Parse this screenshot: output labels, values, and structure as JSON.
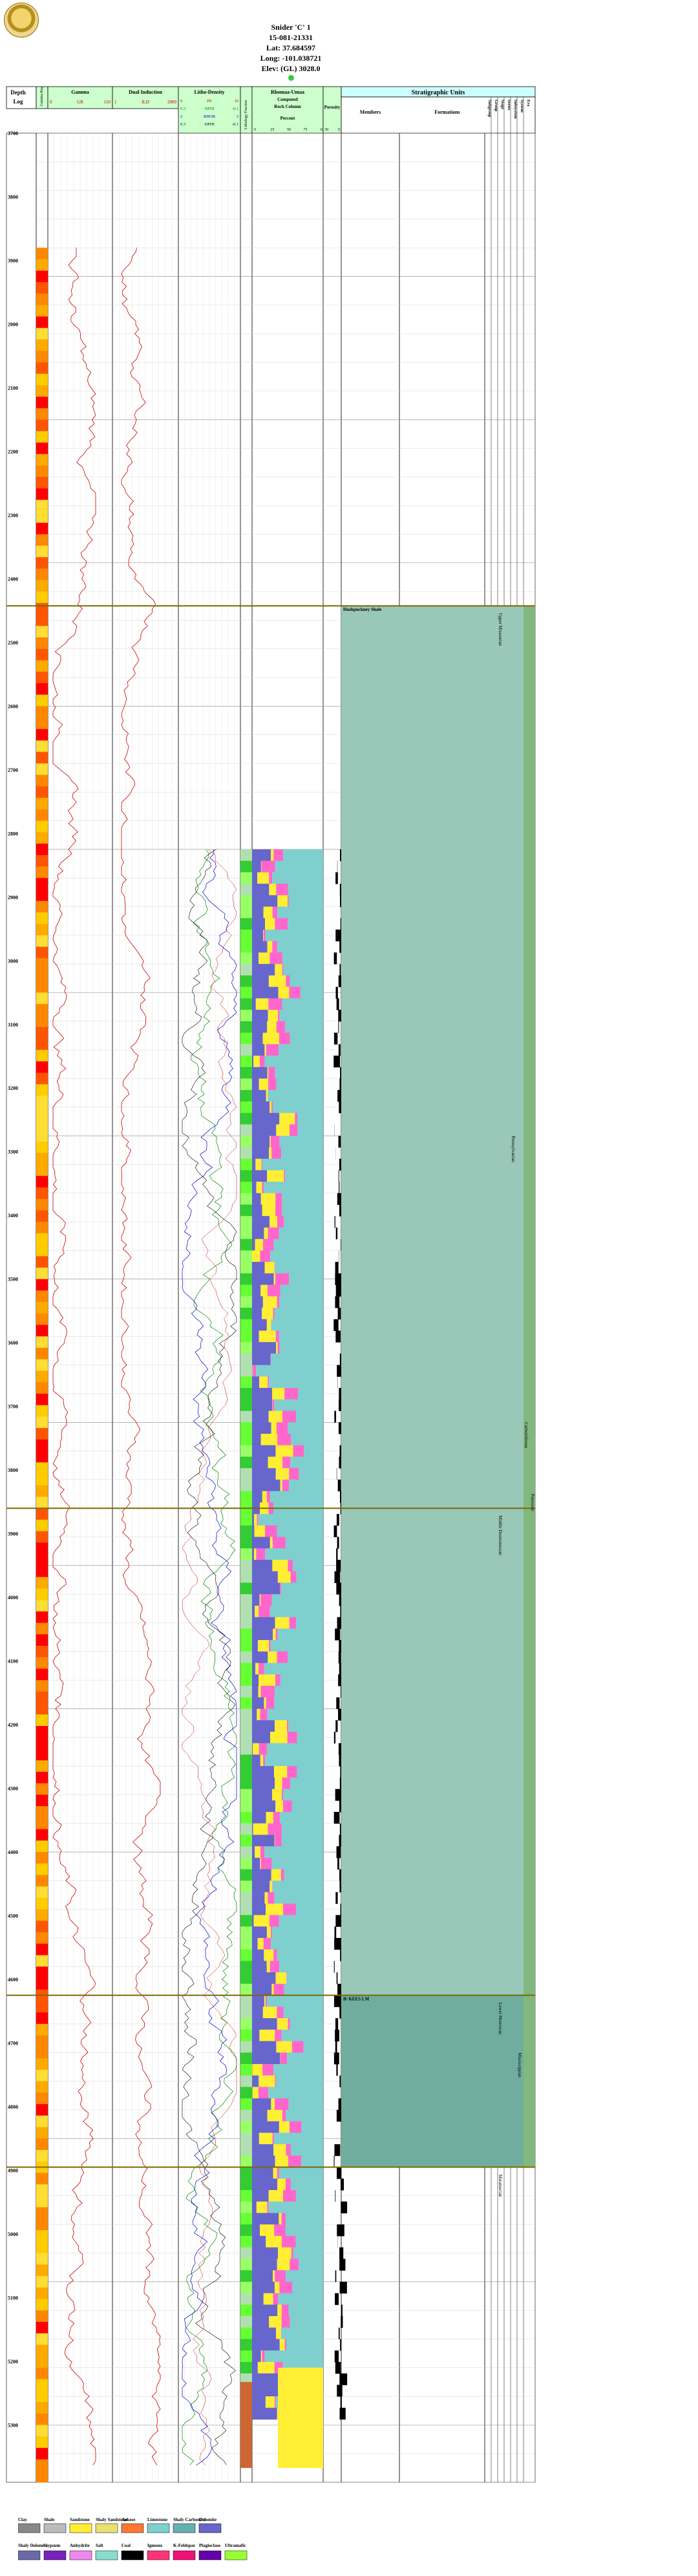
{
  "header": {
    "well_name": "Snider 'C' 1",
    "api": "15-081-21331",
    "lat": "Lat: 37.684597",
    "long": "Long: -101.038721",
    "elev": "Elev: (GL) 3028.0"
  },
  "columns": {
    "depth": [
      "Depth",
      "Log"
    ],
    "gamma_fr": "Gamma Ray",
    "gamma": {
      "title": "Gamma",
      "min": "0",
      "curve": "GR",
      "max": "150"
    },
    "induction": {
      "title": "Dual Induction",
      "min": "1",
      "curve": "ILD",
      "max": "2000"
    },
    "litho": {
      "title": "Litho-Density",
      "rows": [
        {
          "min": "0",
          "curve": "PE",
          "max": "10",
          "color": "#cc0000"
        },
        {
          "min": "0.3",
          "curve": "NPHI",
          "max": "-0.1",
          "color": "#008800"
        },
        {
          "min": "2",
          "curve": "RHOB",
          "max": "3",
          "color": "#0000cc"
        },
        {
          "min": "0.3",
          "curve": "DPHI",
          "max": "-0.1",
          "color": "#000000"
        }
      ]
    },
    "rhomaa_fr": "Lithology Fraction",
    "comp": {
      "title": "Rhomaa-Umaa",
      "sub1": "Computed",
      "sub2": "Rock Column",
      "sub3": "Percent",
      "ticks": [
        "0",
        "25",
        "50",
        "75",
        "100"
      ]
    },
    "porosity": {
      "title": "Porosity",
      "ticks": [
        "30",
        "0"
      ]
    },
    "strat": {
      "title": "Stratigraphic Units",
      "members": "Members",
      "formations": "Formations",
      "verticals": [
        "Subgroup",
        "Group",
        "Stage",
        "Series",
        "Subsystem",
        "System",
        "Era"
      ]
    }
  },
  "depth_ticks": [
    "3700",
    "3800",
    "3900",
    "2000",
    "2100",
    "2200",
    "2300",
    "2400",
    "2500",
    "2600",
    "2700",
    "2800",
    "2900",
    "3000",
    "3100",
    "3200",
    "3300",
    "3400",
    "3500",
    "3600",
    "3700",
    "3800",
    "3900",
    "4000",
    "4100",
    "4200",
    "4300",
    "4400",
    "4500",
    "4600",
    "4700",
    "4800",
    "4900",
    "5000",
    "5100",
    "5200",
    "5300"
  ],
  "tops": [
    {
      "label": "Hushpuckney Shale",
      "depth": 4030
    },
    {
      "label": "",
      "depth": 4660
    },
    {
      "label": "B/ KEES LM",
      "depth": 5000
    },
    {
      "label": "",
      "depth": 5120
    }
  ],
  "strat_labels": {
    "series_upper": "Upper Missourian",
    "series_middle": "Middle Desmoinesian",
    "series_lower": "Lower Morrowan",
    "system": "Pennsylvanian",
    "subsystem": "Mississippian",
    "era": "Paleozoic",
    "era2": "Carboniferous",
    "meramecian": "Meramecian"
  },
  "legend": {
    "row1": [
      "Clay",
      "Shale",
      "Sandstone",
      "Shaly Sandstone",
      "Arkose",
      "Limestone",
      "Shaly Carbonate",
      "Dolomite"
    ],
    "row2": [
      "Shaly Dolomite",
      "Gypsum",
      "Anhydrite",
      "Salt",
      "Coal",
      "Igneous",
      "K-Feldspar",
      "Plagioclase",
      "Ultramafic"
    ]
  }
}
